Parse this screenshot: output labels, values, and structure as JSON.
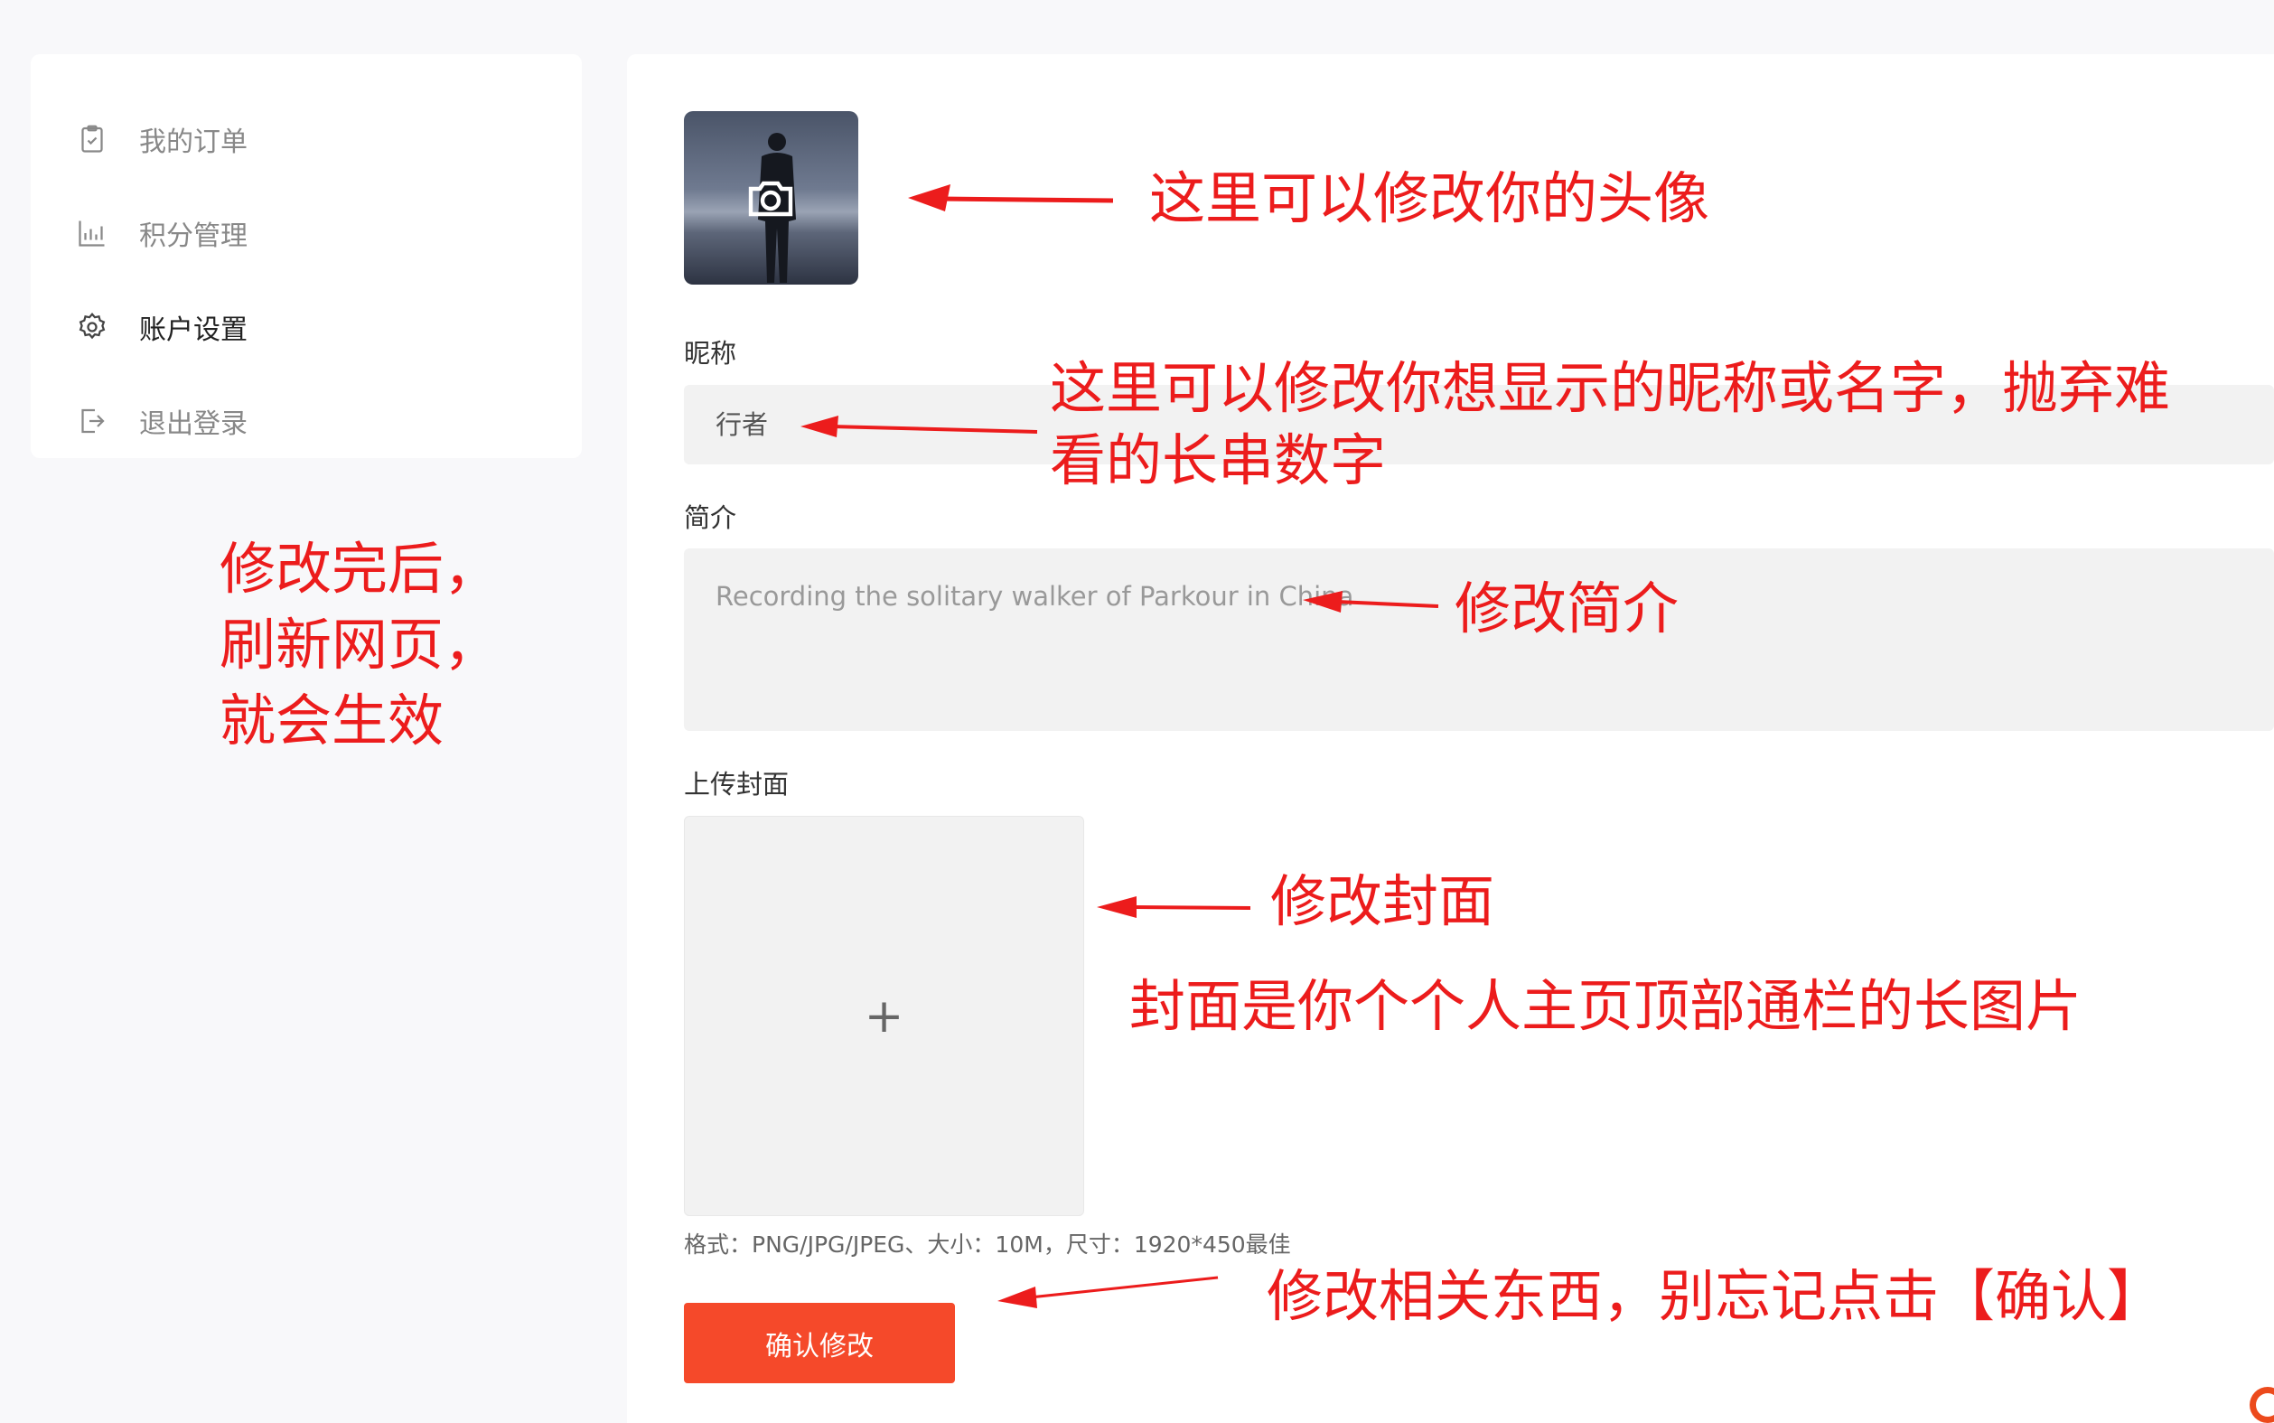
{
  "sidebar": {
    "items": [
      {
        "label": "我的订单",
        "icon": "order-clipboard-icon"
      },
      {
        "label": "积分管理",
        "icon": "chart-icon"
      },
      {
        "label": "账户设置",
        "icon": "gear-icon"
      },
      {
        "label": "退出登录",
        "icon": "logout-icon"
      }
    ],
    "active_index": 2
  },
  "form": {
    "avatar_icon": "camera-icon",
    "nickname_label": "昵称",
    "nickname_value": "行者",
    "intro_label": "简介",
    "intro_value": "Recording the solitary walker of Parkour in China",
    "cover_label": "上传封面",
    "cover_placeholder": "+",
    "cover_hint": "格式：PNG/JPG/JPEG、大小：10M，尺寸：1920*450最佳",
    "confirm_label": "确认修改"
  },
  "annotations": {
    "avatar": "这里可以修改你的头像",
    "nickname_line1": "这里可以修改你想显示的昵称或名字，抛弃难",
    "nickname_line2": "看的长串数字",
    "intro": "修改简介",
    "cover": "修改封面",
    "cover_desc": "封面是你个个人主页顶部通栏的长图片",
    "confirm": "修改相关东西，别忘记点击【确认】",
    "left_line1": "修改完后，",
    "left_line2": "刷新网页，",
    "left_line3": "就会生效",
    "color": "#ec1c1c"
  },
  "theme": {
    "accent": "#f5492a",
    "input_bg": "#f2f2f2",
    "page_bg": "#f8f8fa"
  }
}
